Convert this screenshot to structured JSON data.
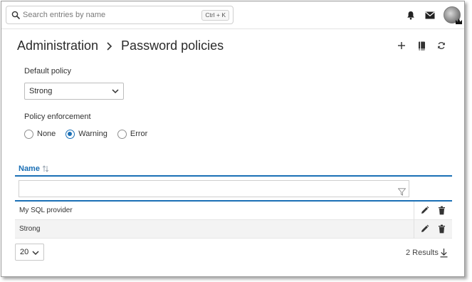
{
  "search": {
    "placeholder": "Search entries by name",
    "shortcut": "Ctrl + K"
  },
  "topbar": {
    "icons": [
      "bell-icon",
      "mail-icon"
    ],
    "avatar": "user-avatar"
  },
  "breadcrumb": {
    "parent": "Administration",
    "current": "Password policies"
  },
  "header_actions": [
    "plus-icon",
    "book-icon",
    "refresh-icon"
  ],
  "form": {
    "default_policy_label": "Default policy",
    "default_policy_value": "Strong",
    "enforcement_label": "Policy enforcement",
    "enforcement_options": [
      {
        "label": "None",
        "selected": false
      },
      {
        "label": "Warning",
        "selected": true
      },
      {
        "label": "Error",
        "selected": false
      }
    ]
  },
  "grid": {
    "column_name": "Name",
    "rows": [
      {
        "name": "My SQL provider"
      },
      {
        "name": "Strong"
      }
    ],
    "page_size": "20",
    "results": "2 Results"
  },
  "colors": {
    "accent": "#1a6fb5",
    "row_alt": "#f3f3f3"
  }
}
